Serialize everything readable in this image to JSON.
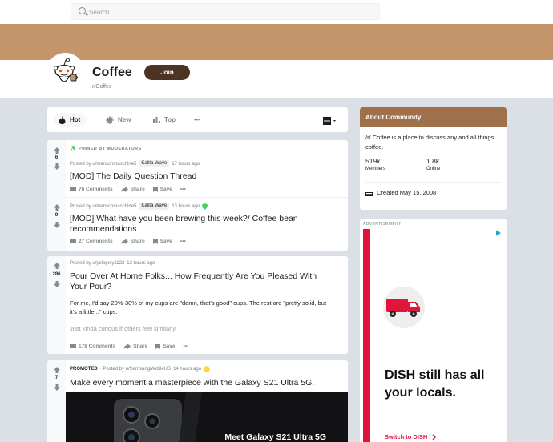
{
  "search": {
    "placeholder": "Search"
  },
  "subreddit": {
    "title": "Coffee",
    "name": "r/Coffee",
    "join_label": "Join"
  },
  "sort": {
    "tabs": [
      {
        "label": "Hot",
        "icon": "flame-icon",
        "active": true
      },
      {
        "label": "New",
        "icon": "sparkle-icon",
        "active": false
      },
      {
        "label": "Top",
        "icon": "bar-chart-icon",
        "active": false
      }
    ],
    "more": "•••",
    "view_icon": "card-view-icon"
  },
  "pinned_label": "PINNED BY MODERATORS",
  "posts": [
    {
      "votes": "6",
      "posted_by": "Posted by u/menschmaschine5",
      "flair": "Kalita Wave",
      "time": "17 hours ago",
      "title": "[MOD] The Daily Question Thread",
      "comments": "76 Comments",
      "share": "Share",
      "save": "Save"
    },
    {
      "votes": "9",
      "posted_by": "Posted by u/menschmaschine5",
      "flair": "Kalita Wave",
      "time": "13 hours ago",
      "title": "[MOD] What have you been brewing this week?/ Coffee bean recommendations",
      "comments": "27 Comments",
      "share": "Share",
      "save": "Save"
    },
    {
      "votes": "286",
      "posted_by": "Posted by u/yelppely1122",
      "time": "12 hours ago",
      "title": "Pour Over At Home Folks... How Frequently Are You Pleased With Your Pour?",
      "body1": "For me, I'd say 20%-30% of my cups are \"damn, that's good\" cups. The rest are \"pretty solid, but it's a little...\" cups.",
      "body2": "Just kinda curious if others feel similarly.",
      "comments": "178 Comments",
      "share": "Share",
      "save": "Save"
    },
    {
      "votes": "7",
      "promoted": "PROMOTED",
      "posted_by": "· Posted by u/SamsungMobileUS",
      "time": "14 hours ago",
      "title": "Make every moment a masterpiece with the Galaxy S21 Ultra 5G.",
      "image_caption": "Meet Galaxy S21 Ultra 5G"
    }
  ],
  "about": {
    "heading": "About Community",
    "description": "/r/ Coffee is a place to discuss any and all things coffee.",
    "members_value": "519k",
    "members_label": "Members",
    "online_value": "1.8k",
    "online_label": "Online",
    "created": "Created May 15, 2008"
  },
  "ad": {
    "label": "ADVERTISEMENT",
    "headline": "DISH still has all your locals.",
    "cta": "Switch to DISH",
    "accent": "#e1143c"
  },
  "colors": {
    "banner": "#c4946b",
    "join": "#4d3324",
    "about_header": "#a0704b"
  }
}
